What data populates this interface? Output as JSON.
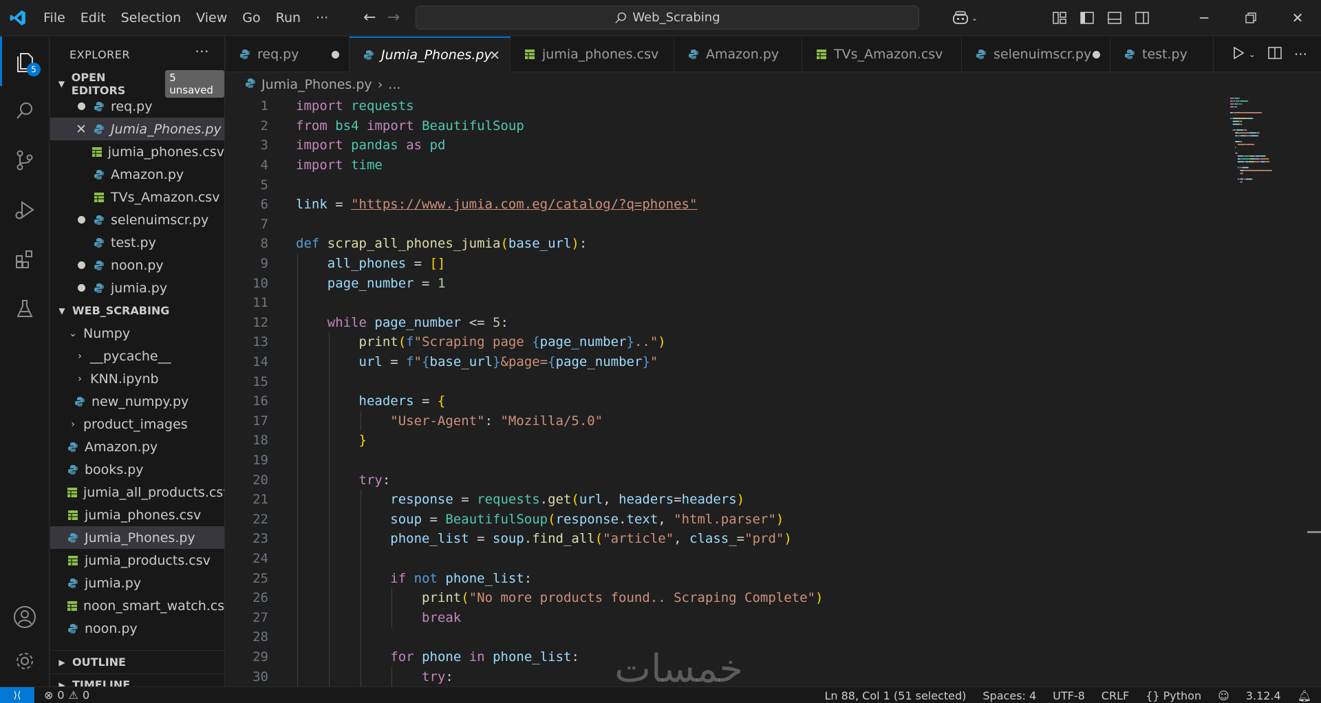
{
  "menu": [
    "File",
    "Edit",
    "Selection",
    "View",
    "Go",
    "Run",
    "···"
  ],
  "command_center": "Web_Scrabing",
  "activity": {
    "explorer_badge": "5"
  },
  "sidebar": {
    "header": "EXPLORER",
    "more": "···",
    "open_editors": {
      "title": "OPEN EDITORS",
      "unsaved": "5 unsaved",
      "items": [
        {
          "name": "req.py",
          "type": "py",
          "state": "dirty"
        },
        {
          "name": "Jumia_Phones.py",
          "type": "py",
          "state": "close"
        },
        {
          "name": "jumia_phones.csv",
          "type": "csv",
          "state": ""
        },
        {
          "name": "Amazon.py",
          "type": "py",
          "state": ""
        },
        {
          "name": "TVs_Amazon.csv",
          "type": "csv",
          "state": ""
        },
        {
          "name": "selenuimscr.py",
          "type": "py",
          "state": "dirty"
        },
        {
          "name": "test.py",
          "type": "py",
          "state": ""
        },
        {
          "name": "noon.py",
          "type": "py",
          "state": "dirty"
        },
        {
          "name": "jumia.py",
          "type": "py",
          "state": "dirty"
        }
      ]
    },
    "workspace": {
      "title": "WEB_SCRABING",
      "items": [
        {
          "name": "Numpy",
          "kind": "folder-open",
          "indent": 0
        },
        {
          "name": "__pycache__",
          "kind": "folder",
          "indent": 1
        },
        {
          "name": "KNN.ipynb",
          "kind": "folder",
          "indent": 1
        },
        {
          "name": "new_numpy.py",
          "kind": "py",
          "indent": 1
        },
        {
          "name": "product_images",
          "kind": "folder",
          "indent": 0
        },
        {
          "name": "Amazon.py",
          "kind": "py",
          "indent": 0
        },
        {
          "name": "books.py",
          "kind": "py",
          "indent": 0
        },
        {
          "name": "jumia_all_products.csv",
          "kind": "csv",
          "indent": 0
        },
        {
          "name": "jumia_phones.csv",
          "kind": "csv",
          "indent": 0
        },
        {
          "name": "Jumia_Phones.py",
          "kind": "py",
          "indent": 0
        },
        {
          "name": "jumia_products.csv",
          "kind": "csv",
          "indent": 0
        },
        {
          "name": "jumia.py",
          "kind": "py",
          "indent": 0
        },
        {
          "name": "noon_smart_watch.csv",
          "kind": "csv",
          "indent": 0
        },
        {
          "name": "noon.py",
          "kind": "py",
          "indent": 0
        }
      ]
    },
    "outline": "OUTLINE",
    "timeline": "TIMELINE"
  },
  "tabs": [
    {
      "label": "req.py",
      "type": "py",
      "state": "dirty",
      "width": 180
    },
    {
      "label": "Jumia_Phones.py",
      "type": "py",
      "state": "close",
      "width": 234,
      "active": true
    },
    {
      "label": "jumia_phones.csv",
      "type": "csv",
      "state": "",
      "width": 238
    },
    {
      "label": "Amazon.py",
      "type": "py",
      "state": "",
      "width": 186
    },
    {
      "label": "TVs_Amazon.csv",
      "type": "csv",
      "state": "",
      "width": 232
    },
    {
      "label": "selenuimscr.py",
      "type": "py",
      "state": "dirty",
      "width": 216
    },
    {
      "label": "test.py",
      "type": "py",
      "state": "",
      "width": 150
    }
  ],
  "breadcrumb": {
    "file": "Jumia_Phones.py",
    "rest": "..."
  },
  "code_lines": [
    [
      [
        "kw-ctrl",
        "import"
      ],
      [
        "plain",
        " "
      ],
      [
        "mod",
        "requests"
      ]
    ],
    [
      [
        "kw-ctrl",
        "from"
      ],
      [
        "plain",
        " "
      ],
      [
        "mod",
        "bs4"
      ],
      [
        "plain",
        " "
      ],
      [
        "kw-ctrl",
        "import"
      ],
      [
        "plain",
        " "
      ],
      [
        "mod",
        "BeautifulSoup"
      ]
    ],
    [
      [
        "kw-ctrl",
        "import"
      ],
      [
        "plain",
        " "
      ],
      [
        "mod",
        "pandas"
      ],
      [
        "plain",
        " "
      ],
      [
        "kw-ctrl",
        "as"
      ],
      [
        "plain",
        " "
      ],
      [
        "mod",
        "pd"
      ]
    ],
    [
      [
        "kw-ctrl",
        "import"
      ],
      [
        "plain",
        " "
      ],
      [
        "mod",
        "time"
      ]
    ],
    [],
    [
      [
        "var",
        "link"
      ],
      [
        "plain",
        " = "
      ],
      [
        "url",
        "\"https://www.jumia.com.eg/catalog/?q=phones\""
      ]
    ],
    [],
    [
      [
        "kw",
        "def"
      ],
      [
        "plain",
        " "
      ],
      [
        "fn",
        "scrap_all_phones_jumia"
      ],
      [
        "br1",
        "("
      ],
      [
        "var",
        "base_url"
      ],
      [
        "br1",
        ")"
      ],
      [
        "plain",
        ":"
      ]
    ],
    [
      [
        "plain",
        "    "
      ],
      [
        "var",
        "all_phones"
      ],
      [
        "plain",
        " = "
      ],
      [
        "br1",
        "[]"
      ]
    ],
    [
      [
        "plain",
        "    "
      ],
      [
        "var",
        "page_number"
      ],
      [
        "plain",
        " = "
      ],
      [
        "num",
        "1"
      ]
    ],
    [],
    [
      [
        "plain",
        "    "
      ],
      [
        "kw-ctrl",
        "while"
      ],
      [
        "plain",
        " "
      ],
      [
        "var",
        "page_number"
      ],
      [
        "plain",
        " <= "
      ],
      [
        "num",
        "5"
      ],
      [
        "plain",
        ":"
      ]
    ],
    [
      [
        "plain",
        "        "
      ],
      [
        "fn",
        "print"
      ],
      [
        "br1",
        "("
      ],
      [
        "kw",
        "f"
      ],
      [
        "str",
        "\"Scraping page "
      ],
      [
        "kw",
        "{"
      ],
      [
        "var",
        "page_number"
      ],
      [
        "kw",
        "}"
      ],
      [
        "str",
        "..\""
      ],
      [
        "br1",
        ")"
      ]
    ],
    [
      [
        "plain",
        "        "
      ],
      [
        "var",
        "url"
      ],
      [
        "plain",
        " = "
      ],
      [
        "kw",
        "f"
      ],
      [
        "str",
        "\""
      ],
      [
        "kw",
        "{"
      ],
      [
        "var",
        "base_url"
      ],
      [
        "kw",
        "}"
      ],
      [
        "str",
        "&page="
      ],
      [
        "kw",
        "{"
      ],
      [
        "var",
        "page_number"
      ],
      [
        "kw",
        "}"
      ],
      [
        "str",
        "\""
      ]
    ],
    [],
    [
      [
        "plain",
        "        "
      ],
      [
        "var",
        "headers"
      ],
      [
        "plain",
        " = "
      ],
      [
        "br1",
        "{"
      ]
    ],
    [
      [
        "plain",
        "            "
      ],
      [
        "str",
        "\"User-Agent\""
      ],
      [
        "plain",
        ": "
      ],
      [
        "str",
        "\"Mozilla/5.0\""
      ]
    ],
    [
      [
        "plain",
        "        "
      ],
      [
        "br1",
        "}"
      ]
    ],
    [],
    [
      [
        "plain",
        "        "
      ],
      [
        "kw-ctrl",
        "try"
      ],
      [
        "plain",
        ":"
      ]
    ],
    [
      [
        "plain",
        "            "
      ],
      [
        "var",
        "response"
      ],
      [
        "plain",
        " = "
      ],
      [
        "mod",
        "requests"
      ],
      [
        "plain",
        "."
      ],
      [
        "fn",
        "get"
      ],
      [
        "br1",
        "("
      ],
      [
        "var",
        "url"
      ],
      [
        "plain",
        ", "
      ],
      [
        "var",
        "headers"
      ],
      [
        "plain",
        "="
      ],
      [
        "var",
        "headers"
      ],
      [
        "br1",
        ")"
      ]
    ],
    [
      [
        "plain",
        "            "
      ],
      [
        "var",
        "soup"
      ],
      [
        "plain",
        " = "
      ],
      [
        "mod",
        "BeautifulSoup"
      ],
      [
        "br1",
        "("
      ],
      [
        "var",
        "response"
      ],
      [
        "plain",
        "."
      ],
      [
        "var",
        "text"
      ],
      [
        "plain",
        ", "
      ],
      [
        "str",
        "\"html.parser\""
      ],
      [
        "br1",
        ")"
      ]
    ],
    [
      [
        "plain",
        "            "
      ],
      [
        "var",
        "phone_list"
      ],
      [
        "plain",
        " = "
      ],
      [
        "var",
        "soup"
      ],
      [
        "plain",
        "."
      ],
      [
        "fn",
        "find_all"
      ],
      [
        "br1",
        "("
      ],
      [
        "str",
        "\"article\""
      ],
      [
        "plain",
        ", "
      ],
      [
        "var",
        "class_"
      ],
      [
        "plain",
        "="
      ],
      [
        "str",
        "\"prd\""
      ],
      [
        "br1",
        ")"
      ]
    ],
    [],
    [
      [
        "plain",
        "            "
      ],
      [
        "kw-ctrl",
        "if"
      ],
      [
        "plain",
        " "
      ],
      [
        "kw",
        "not"
      ],
      [
        "plain",
        " "
      ],
      [
        "var",
        "phone_list"
      ],
      [
        "plain",
        ":"
      ]
    ],
    [
      [
        "plain",
        "                "
      ],
      [
        "fn",
        "print"
      ],
      [
        "br1",
        "("
      ],
      [
        "str",
        "\"No more products found.. Scraping Complete\""
      ],
      [
        "br1",
        ")"
      ]
    ],
    [
      [
        "plain",
        "                "
      ],
      [
        "kw-ctrl",
        "break"
      ]
    ],
    [],
    [
      [
        "plain",
        "            "
      ],
      [
        "kw-ctrl",
        "for"
      ],
      [
        "plain",
        " "
      ],
      [
        "var",
        "phone"
      ],
      [
        "plain",
        " "
      ],
      [
        "kw-ctrl",
        "in"
      ],
      [
        "plain",
        " "
      ],
      [
        "var",
        "phone_list"
      ],
      [
        "plain",
        ":"
      ]
    ],
    [
      [
        "plain",
        "                "
      ],
      [
        "kw-ctrl",
        "try"
      ],
      [
        "plain",
        ":"
      ]
    ]
  ],
  "watermark": "خمسات",
  "status": {
    "errors": "0",
    "warnings": "0",
    "position": "Ln 88, Col 1 (51 selected)",
    "spaces": "Spaces: 4",
    "encoding": "UTF-8",
    "eol": "CRLF",
    "language": "Python",
    "version": "3.12.4"
  },
  "colors": {
    "accent": "#0078d4",
    "py_icon": "#519aba",
    "csv_icon": "#8dc149"
  }
}
